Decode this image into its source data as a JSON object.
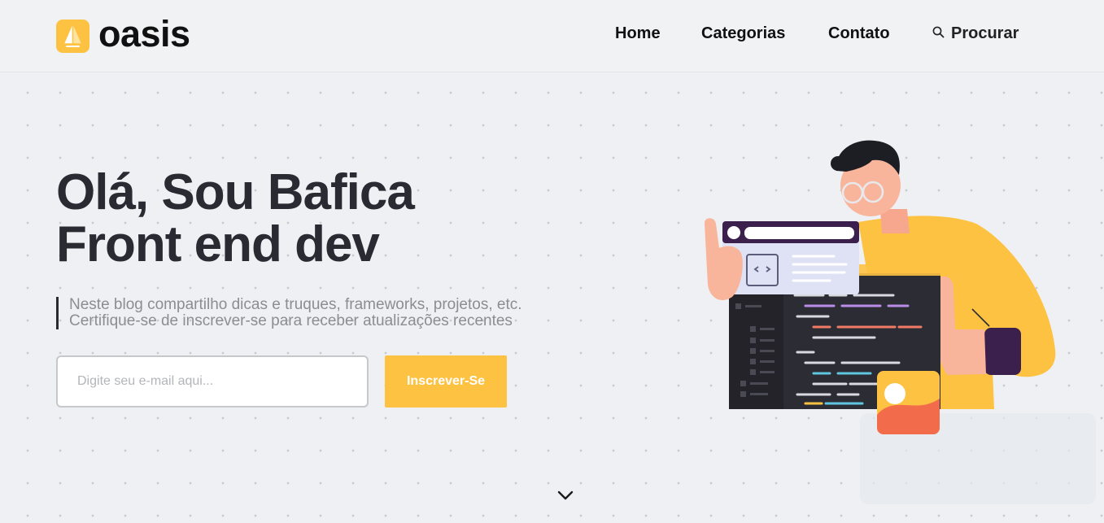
{
  "brand": {
    "name": "oasis",
    "accent": "#fdc242"
  },
  "nav": {
    "items": [
      {
        "label": "Home"
      },
      {
        "label": "Categorias"
      },
      {
        "label": "Contato"
      }
    ],
    "search_label": "Procurar",
    "search_icon": "search-icon"
  },
  "hero": {
    "title_line1": "Olá, Sou Bafica",
    "title_line2": "Front end dev",
    "desc_line1": "Neste blog compartilho dicas e truques, frameworks, projetos, etc.",
    "desc_line2": "Certifique-se de inscrever-se para receber atualizações recentes",
    "email_placeholder": "Digite seu e-mail aqui...",
    "subscribe_label": "Inscrever-Se"
  },
  "scroll_icon": "chevron-down-icon",
  "colors": {
    "text_dark": "#2a2a33",
    "muted": "#8b8d92",
    "background": "#eef0f3"
  }
}
